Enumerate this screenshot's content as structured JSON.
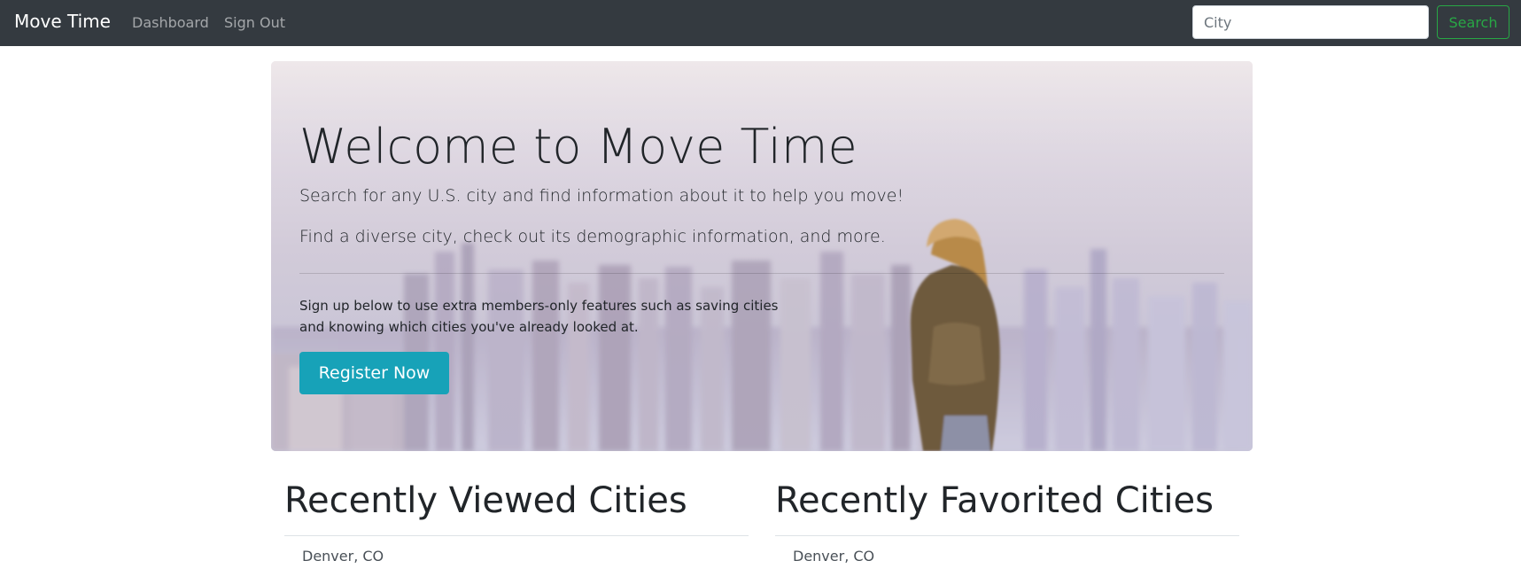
{
  "navbar": {
    "brand": "Move Time",
    "links": [
      {
        "label": "Dashboard"
      },
      {
        "label": "Sign Out"
      }
    ],
    "search": {
      "placeholder": "City",
      "value": "",
      "button_label": "Search"
    }
  },
  "hero": {
    "title": "Welcome to Move Time",
    "lead_1": "Search for any U.S. city and find information about it to help you move!",
    "lead_2": "Find a diverse city, check out its demographic information, and more.",
    "note_line_1": "Sign up below to use extra members-only features such as saving cities",
    "note_line_2": "and knowing which cities you've already looked at.",
    "button_label": "Register Now"
  },
  "recently_viewed": {
    "title": "Recently Viewed Cities",
    "items": [
      "Denver, CO"
    ]
  },
  "recently_favorited": {
    "title": "Recently Favorited Cities",
    "items": [
      "Denver, CO"
    ]
  },
  "colors": {
    "navbar_bg": "#343a40",
    "success": "#28a745",
    "info": "#17a2b8"
  }
}
